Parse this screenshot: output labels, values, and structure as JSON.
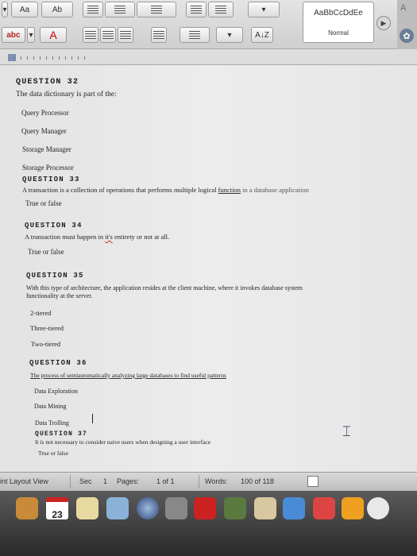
{
  "ribbon": {
    "font_size_label": "Aa",
    "text_effect_label": "Ab",
    "highlight_label": "abc",
    "font_color_label": "A",
    "sort_label": "A↓Z",
    "styles_sample": "AaBbCcDdEe",
    "style_name": "Normal",
    "right_label": "A"
  },
  "document": {
    "questions": [
      {
        "title": "QUESTION 32",
        "text": "The data dictionary is part of the:",
        "options": [
          "Query Processor",
          "Query Manager",
          "Storage Manager",
          "Storage Processor"
        ]
      },
      {
        "title": "QUESTION 33",
        "text_parts": [
          "A transaction is a collection of operations that performs multiple logical ",
          "function",
          " in a database application"
        ],
        "options": [
          "True or false"
        ]
      },
      {
        "title": "QUESTION 34",
        "text_parts": [
          "A transaction must happen in ",
          "it's",
          " entirety or not at all."
        ],
        "options": [
          "True or false"
        ]
      },
      {
        "title": "QUESTION 35",
        "text": "With this type of architecture, the application resides at the client machine, where it invokes database system",
        "text2": "functionality at the server.",
        "options": [
          "2-tiered",
          "Three-tiered",
          "Two-tiered"
        ]
      },
      {
        "title": "QUESTION 36",
        "text": "The process of semiautomatically analyzing large databases to find useful patterns",
        "options": [
          "Data Exploration",
          "Data Mining",
          "Data Trolling"
        ]
      },
      {
        "title": "QUESTION 37",
        "text": "It is not necessary to consider naive users when designing a user interface",
        "options": [
          "True or false"
        ]
      }
    ]
  },
  "status": {
    "view": "int Layout View",
    "sec_label": "Sec",
    "sec_value": "1",
    "pages_label": "Pages:",
    "pages_value": "1 of 1",
    "words_label": "Words:",
    "words_value": "100 of 118"
  },
  "dock": {
    "calendar_day": "23"
  }
}
